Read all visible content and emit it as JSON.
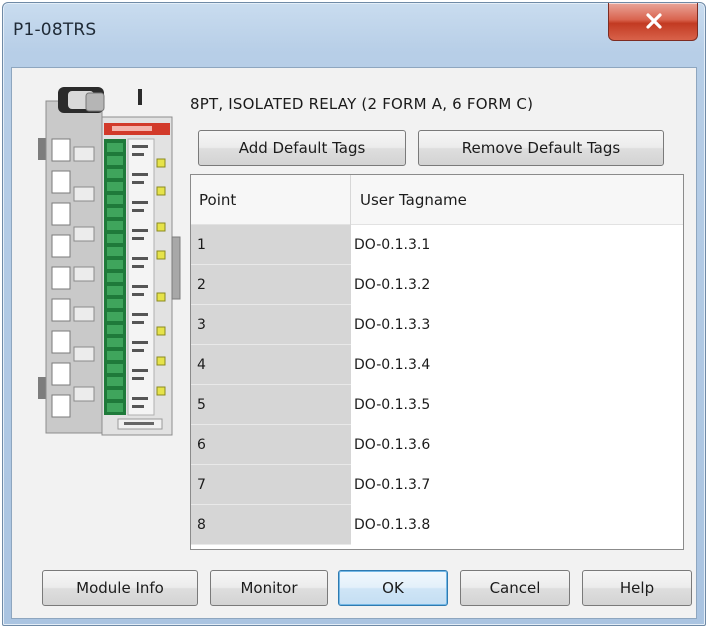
{
  "window": {
    "title": "P1-08TRS"
  },
  "module": {
    "description": "8PT, ISOLATED RELAY (2 FORM A, 6 FORM C)",
    "image_name": "P1-08TRS module illustration"
  },
  "toolbar": {
    "add_default_tags": "Add Default Tags",
    "remove_default_tags": "Remove Default Tags"
  },
  "grid": {
    "columns": [
      "Point",
      "User Tagname"
    ],
    "rows": [
      {
        "point": "1",
        "tag": "DO-0.1.3.1"
      },
      {
        "point": "2",
        "tag": "DO-0.1.3.2"
      },
      {
        "point": "3",
        "tag": "DO-0.1.3.3"
      },
      {
        "point": "4",
        "tag": "DO-0.1.3.4"
      },
      {
        "point": "5",
        "tag": "DO-0.1.3.5"
      },
      {
        "point": "6",
        "tag": "DO-0.1.3.6"
      },
      {
        "point": "7",
        "tag": "DO-0.1.3.7"
      },
      {
        "point": "8",
        "tag": "DO-0.1.3.8"
      }
    ]
  },
  "footer": {
    "module_info": "Module Info",
    "monitor": "Monitor",
    "ok": "OK",
    "cancel": "Cancel",
    "help": "Help"
  },
  "colors": {
    "title_bar": "#b7cee7",
    "close_button": "#c94a33",
    "module_label_red": "#d23a2a",
    "terminal_green": "#1f7a3a",
    "status_led_yellow": "#e6e34a",
    "point_cell_gray": "#d6d6d6"
  }
}
